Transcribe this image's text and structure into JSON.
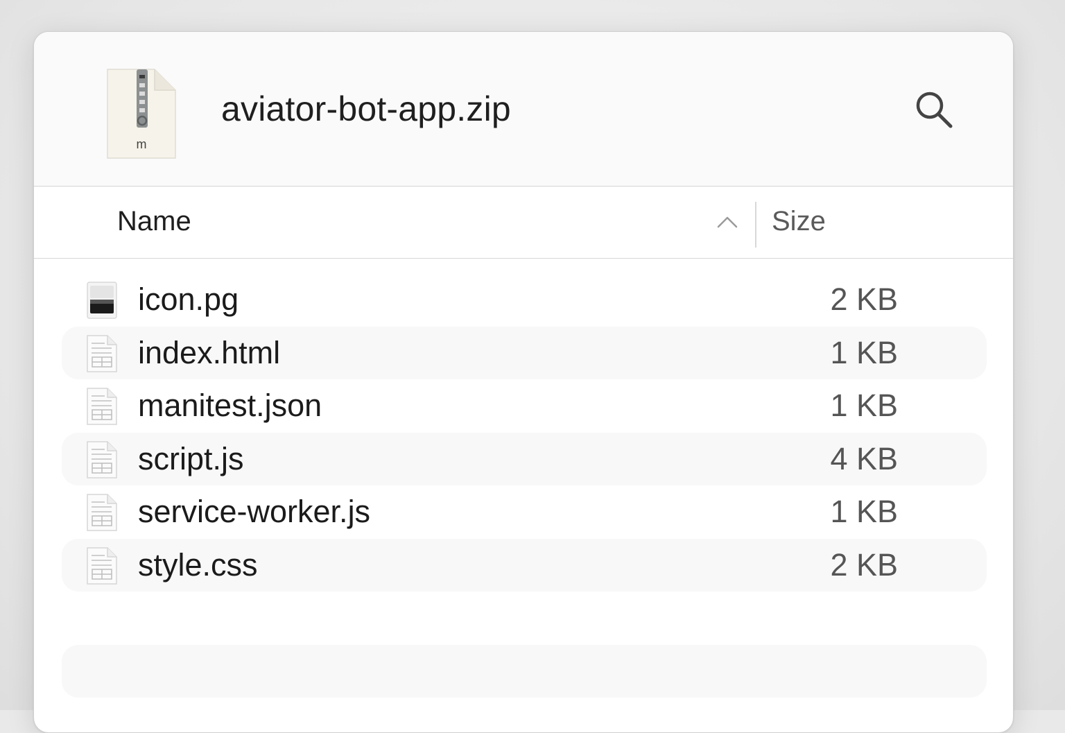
{
  "window": {
    "title": "aviator-bot-app.zip",
    "archive_icon_label": "m"
  },
  "header_icons": {
    "archive": "zip-file-icon",
    "search": "search-icon"
  },
  "columns": {
    "name_label": "Name",
    "size_label": "Size",
    "sort_direction": "ascending"
  },
  "files": [
    {
      "name": "icon.pg",
      "size": "2 KB",
      "icon": "image-file-icon"
    },
    {
      "name": "index.html",
      "size": "1 KB",
      "icon": "document-icon"
    },
    {
      "name": "manitest.json",
      "size": "1 KB",
      "icon": "document-icon"
    },
    {
      "name": "script.js",
      "size": "4 KB",
      "icon": "document-icon"
    },
    {
      "name": "service-worker.js",
      "size": "1 KB",
      "icon": "document-icon"
    },
    {
      "name": "style.css",
      "size": "2 KB",
      "icon": "document-icon"
    }
  ],
  "colors": {
    "window_bg": "#ffffff",
    "header_bg": "#fafafa",
    "alt_row_bg": "#f8f8f8",
    "text_primary": "#1b1b1b",
    "text_secondary": "#555555"
  }
}
